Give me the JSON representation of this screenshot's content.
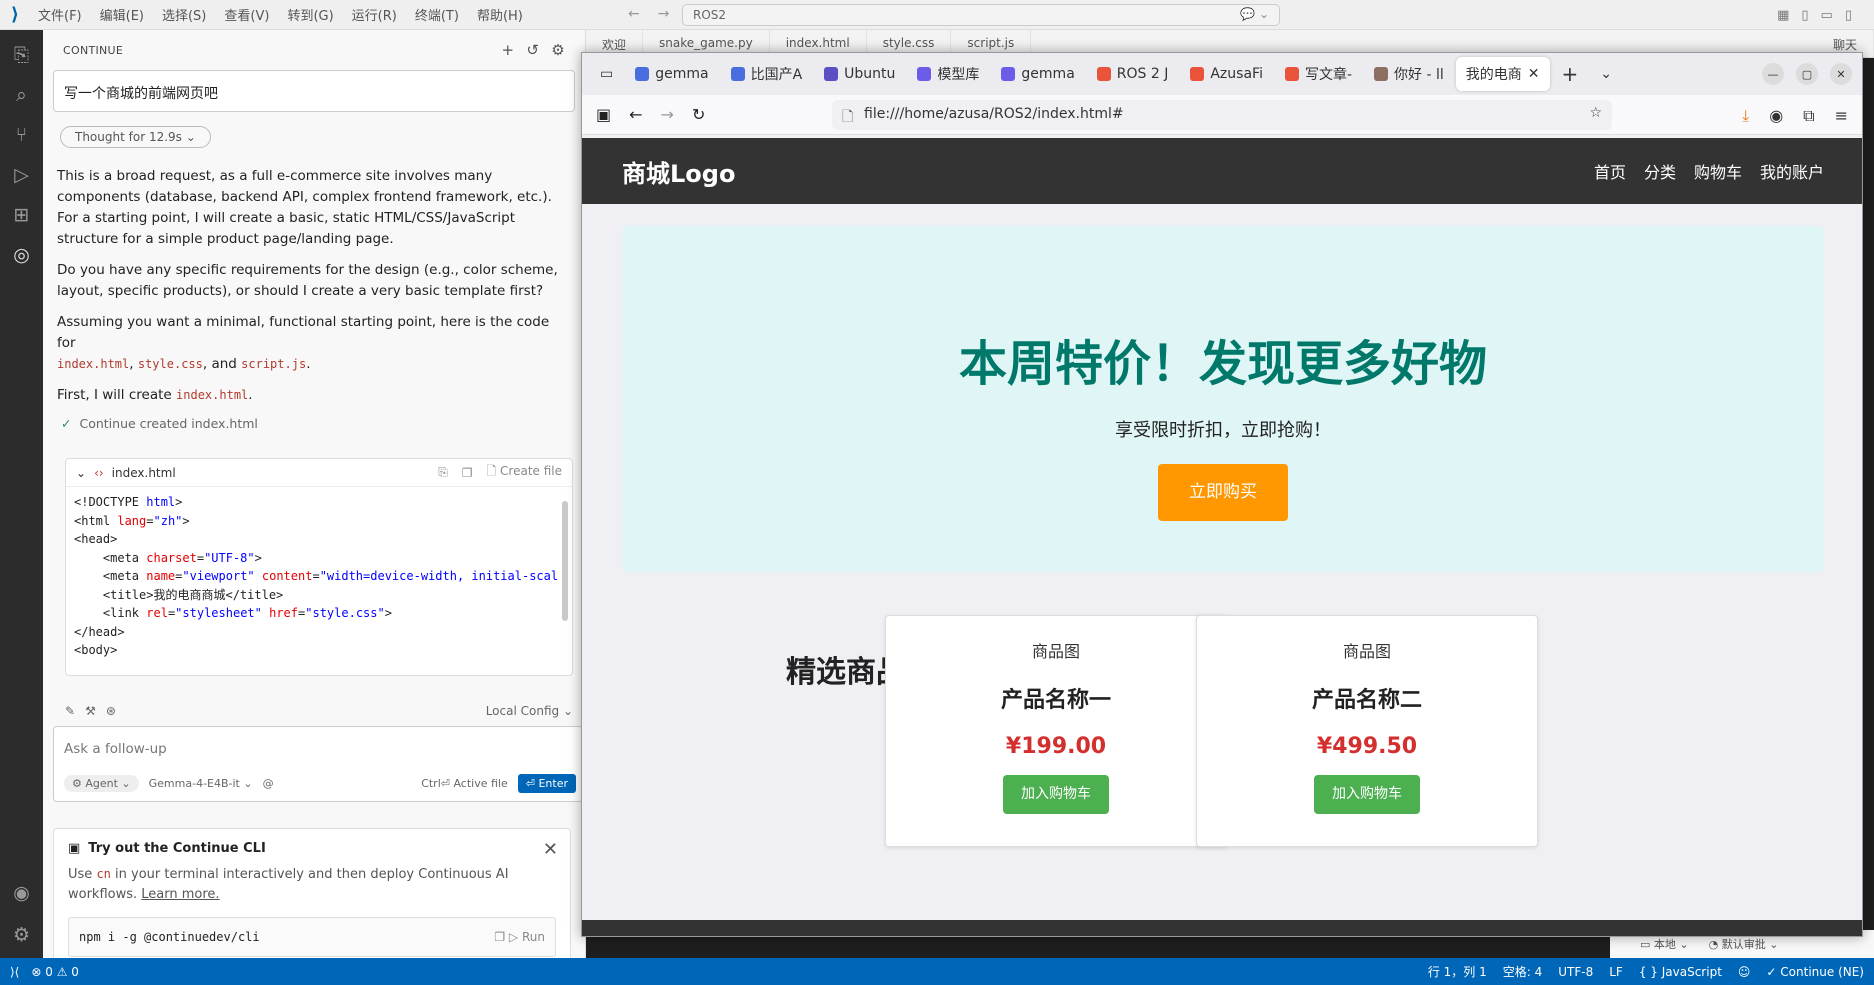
{
  "vscode": {
    "menu": [
      "文件(F)",
      "编辑(E)",
      "选择(S)",
      "查看(V)",
      "转到(G)",
      "运行(R)",
      "终端(T)",
      "帮助(H)"
    ],
    "search": "ROS2",
    "tabs": [
      "欢迎",
      "snake_game.py",
      "index.html",
      "style.css",
      "script.js",
      "聊天"
    ],
    "status": {
      "problems": "⊗ 0 ⚠ 0",
      "position": "行 1，列 1",
      "spaces": "空格: 4",
      "encoding": "UTF-8",
      "eol": "LF",
      "language": "{ } JavaScript",
      "continue": "✓ Continue (NE)"
    },
    "panel_bottom": {
      "local": "本地",
      "review": "默认审批"
    }
  },
  "sidebar": {
    "title": "CONTINUE",
    "prompt": "写一个商城的前端网页吧",
    "thought": "Thought for 12.9s",
    "para1": "This is a broad request, as a full e-commerce site involves many components (database, backend API, complex frontend framework, etc.). For a starting point, I will create a basic, static HTML/CSS/JavaScript structure for a simple product page/landing page.",
    "para2": "Do you have any specific requirements for the design (e.g., color scheme, layout, specific products), or should I create a very basic template first?",
    "para3_pre": "Assuming you want a minimal, functional starting point, here is the code for",
    "file1": "index.html",
    "file2": "style.css",
    "file3": "script.js",
    "para3_and": ", and",
    "para4_pre": "First, I will create",
    "created": "Continue created index.html",
    "codeblock": {
      "filename": "index.html",
      "create": "Create file"
    },
    "config": "Local Config",
    "followup": {
      "placeholder": "Ask a follow-up",
      "agent": "Agent",
      "model": "Gemma-4-E4B-it",
      "active_file": "Ctrl⏎ Active file",
      "enter": "⏎ Enter"
    },
    "cli": {
      "title": "Try out the Continue CLI",
      "desc_pre": "Use",
      "cmd_inline": "cn",
      "desc_post": "in your terminal interactively and then deploy Continuous AI workflows.",
      "learn": "Learn more.",
      "cmd": "npm i -g @continuedev/cli",
      "run": "Run"
    }
  },
  "firefox": {
    "tabs": [
      "gemma",
      "比国产A",
      "Ubuntu",
      "模型库",
      "gemma",
      "ROS 2 J",
      "AzusaFi",
      "写文章-",
      "你好 - ll",
      "我的电商"
    ],
    "url": "file:///home/azusa/ROS2/index.html#"
  },
  "site": {
    "logo": "商城Logo",
    "nav": [
      "首页",
      "分类",
      "购物车",
      "我的账户"
    ],
    "hero_title": "本周特价！发现更多好物",
    "hero_sub": "享受限时折扣，立即抢购！",
    "hero_btn": "立即购买",
    "featured": "精选商品",
    "products": [
      {
        "img": "商品图",
        "name": "产品名称一",
        "price": "¥199.00",
        "btn": "加入购物车"
      },
      {
        "img": "商品图",
        "name": "产品名称二",
        "price": "¥499.50",
        "btn": "加入购物车"
      }
    ]
  }
}
